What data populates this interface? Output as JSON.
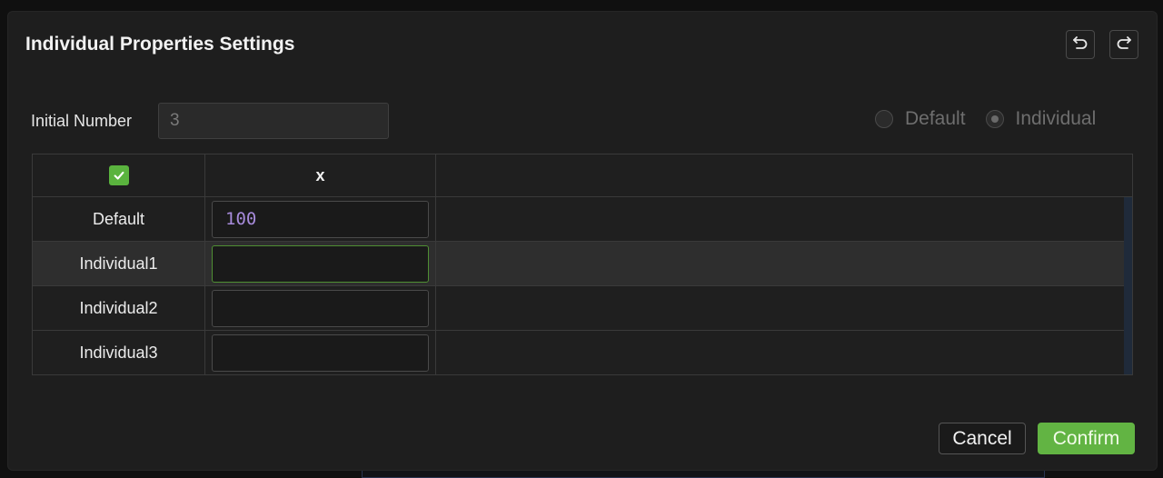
{
  "dialog": {
    "title": "Individual Properties Settings",
    "undo_icon": "undo-icon",
    "redo_icon": "redo-icon"
  },
  "initial_number": {
    "label": "Initial Number",
    "value": "3"
  },
  "mode": {
    "options": [
      "Default",
      "Individual"
    ],
    "selected": "Individual"
  },
  "table": {
    "header_checked": true,
    "column": "x",
    "rows": [
      {
        "label": "Default",
        "value": "100"
      },
      {
        "label": "Individual1",
        "value": ""
      },
      {
        "label": "Individual2",
        "value": ""
      },
      {
        "label": "Individual3",
        "value": ""
      }
    ]
  },
  "footer": {
    "cancel_label": "Cancel",
    "confirm_label": "Confirm"
  },
  "colors": {
    "accent_green": "#62b443",
    "value_purple": "#a78bdb"
  }
}
